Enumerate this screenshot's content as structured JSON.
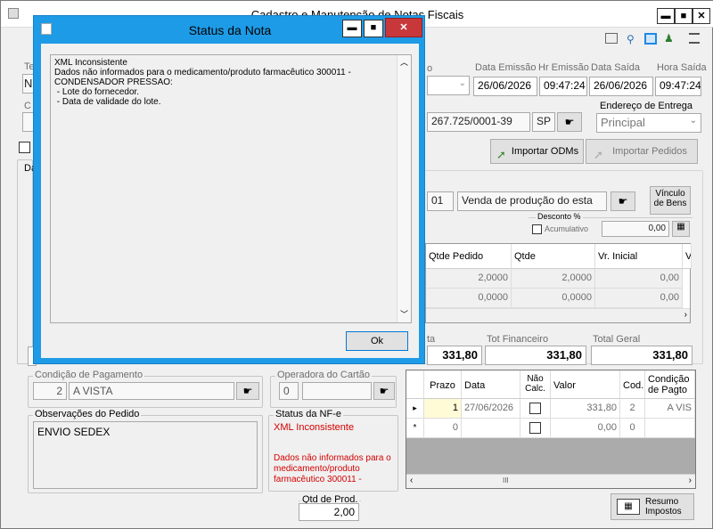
{
  "window": {
    "title": "Cadastro e Manutenção de Notas Fiscais",
    "min": "▬",
    "max": "■",
    "close": "✕"
  },
  "left_labels": {
    "te": "Te",
    "n": "N",
    "c": "C",
    "da": "Da"
  },
  "header": {
    "o_label": "o",
    "data_emissao_label": "Data Emissão",
    "hr_emissao_label": "Hr Emissão",
    "data_saida_label": "Data Saída",
    "hora_saida_label": "Hora Saída",
    "data_emissao": "26/06/2026",
    "hr_emissao": "09:47:24",
    "data_saida": "26/06/2026",
    "hora_saida": "09:47:24",
    "cnpj": "267.725/0001-39",
    "uf": "SP",
    "endereco_label": "Endereço de Entrega",
    "endereco_value": "Principal"
  },
  "buttons": {
    "importar_odms": "Importar ODMs",
    "importar_pedidos": "Importar Pedidos",
    "vinculo_line1": "Vínculo",
    "vinculo_line2": "de Bens",
    "resumo_line1": "Resumo",
    "resumo_line2": "Impostos"
  },
  "operation": {
    "code": "01",
    "description": "Venda de produção do esta"
  },
  "desconto": {
    "label": "Desconto %",
    "acumulativo": "Acumulativo",
    "value": "0,00"
  },
  "items_grid": {
    "headers": [
      "Qtde Pedido",
      "Qtde",
      "Vr. Inicial",
      "V"
    ],
    "rows": [
      [
        "2,0000",
        "2,0000",
        "0,00"
      ],
      [
        "0,0000",
        "0,0000",
        "0,00"
      ]
    ]
  },
  "totals": {
    "ta_label": "ta",
    "ta_value": "331,80",
    "financeiro_label": "Tot Financeiro",
    "financeiro_value": "331,80",
    "geral_label": "Total Geral",
    "geral_value": "331,80"
  },
  "pagamento": {
    "label": "Condição de Pagamento",
    "code": "2",
    "value": "A VISTA"
  },
  "operadora": {
    "label": "Operadora do Cartão",
    "code": "0"
  },
  "obs": {
    "label": "Observações do Pedido",
    "value": "ENVIO SEDEX"
  },
  "status_nfe": {
    "label": "Status da NF-e",
    "status": "XML Inconsistente",
    "detail_line1": "Dados não informados para o",
    "detail_line2": "medicamento/produto",
    "detail_line3": "farmacêutico 300011 -"
  },
  "qtd_prod": {
    "label": "Qtd de Prod.",
    "value": "2,00"
  },
  "parcelas_grid": {
    "headers": [
      "Prazo",
      "Data",
      "Não Calc.",
      "Valor",
      "Cod.",
      "Condição de Pagto"
    ],
    "hdr_naocalc_1": "Não",
    "hdr_naocalc_2": "Calc.",
    "hdr_cond_1": "Condição",
    "hdr_cond_2": "de Pagto",
    "row1": {
      "marker": "▸",
      "prazo": "1",
      "data": "27/06/2026",
      "valor": "331,80",
      "cod": "2",
      "cond": "A VIS"
    },
    "row2": {
      "marker": "*",
      "prazo": "0",
      "valor": "0,00",
      "cod": "0"
    },
    "scroll_mid": "III"
  },
  "dialog": {
    "title": "Status da Nota",
    "min": "▬",
    "max": "■",
    "close": "✕",
    "lines": [
      "XML Inconsistente",
      "Dados não informados para o medicamento/produto farmacêutico 300011 -",
      "CONDENSADOR PRESSAO:",
      " - Lote do fornecedor.",
      " - Data de validade do lote."
    ],
    "ok": "Ok"
  }
}
